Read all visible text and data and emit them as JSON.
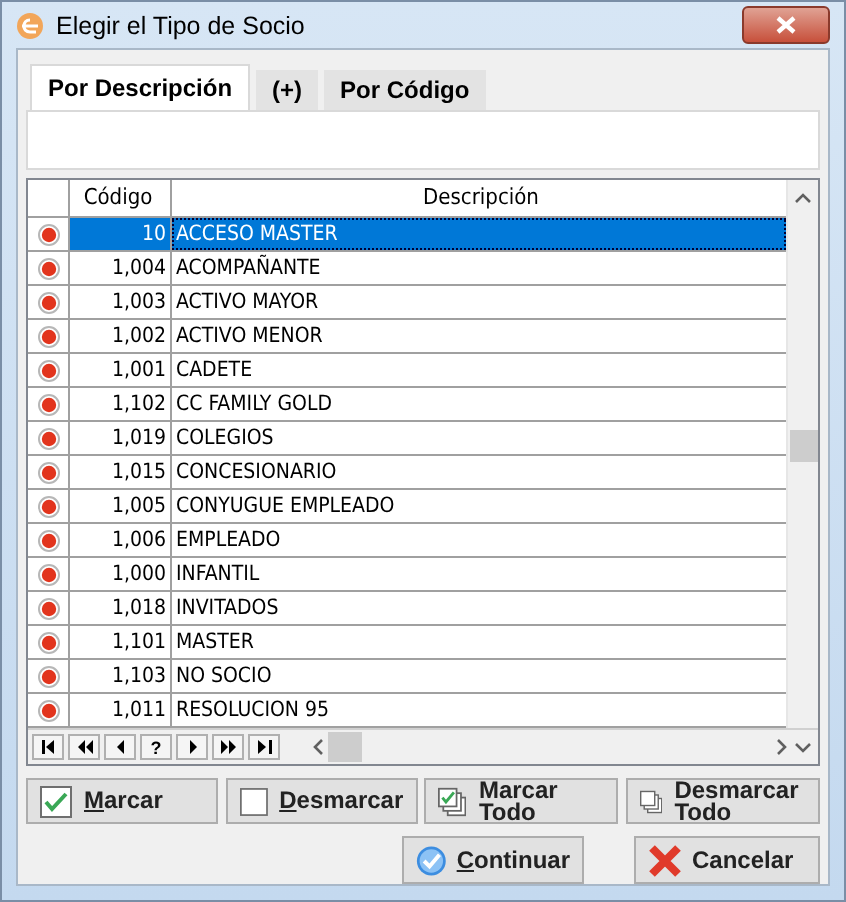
{
  "window": {
    "title": "Elegir el Tipo de Socio"
  },
  "tabs": [
    {
      "label": "Por Descripción",
      "selected": true
    },
    {
      "label": "(+)",
      "selected": false
    },
    {
      "label": "Por Código",
      "selected": false
    }
  ],
  "table": {
    "columns": [
      "Código",
      "Descripción"
    ],
    "rows": [
      {
        "codigo": "10",
        "descripcion": "ACCESO MASTER",
        "selected": true
      },
      {
        "codigo": "1,004",
        "descripcion": "ACOMPAÑANTE",
        "selected": false
      },
      {
        "codigo": "1,003",
        "descripcion": "ACTIVO MAYOR",
        "selected": false
      },
      {
        "codigo": "1,002",
        "descripcion": "ACTIVO MENOR",
        "selected": false
      },
      {
        "codigo": "1,001",
        "descripcion": "CADETE",
        "selected": false
      },
      {
        "codigo": "1,102",
        "descripcion": "CC FAMILY GOLD",
        "selected": false
      },
      {
        "codigo": "1,019",
        "descripcion": "COLEGIOS",
        "selected": false
      },
      {
        "codigo": "1,015",
        "descripcion": "CONCESIONARIO",
        "selected": false
      },
      {
        "codigo": "1,005",
        "descripcion": "CONYUGUE EMPLEADO",
        "selected": false
      },
      {
        "codigo": "1,006",
        "descripcion": "EMPLEADO",
        "selected": false
      },
      {
        "codigo": "1,000",
        "descripcion": "INFANTIL",
        "selected": false
      },
      {
        "codigo": "1,018",
        "descripcion": "INVITADOS",
        "selected": false
      },
      {
        "codigo": "1,101",
        "descripcion": "MASTER",
        "selected": false
      },
      {
        "codigo": "1,103",
        "descripcion": "NO SOCIO",
        "selected": false
      },
      {
        "codigo": "1,011",
        "descripcion": "RESOLUCION 95",
        "selected": false
      }
    ]
  },
  "navigator": [
    {
      "kind": "first"
    },
    {
      "kind": "prior_page"
    },
    {
      "kind": "prior"
    },
    {
      "kind": "text",
      "label": "?"
    },
    {
      "kind": "next"
    },
    {
      "kind": "next_page"
    },
    {
      "kind": "last"
    }
  ],
  "mark_buttons": [
    {
      "kind": "check",
      "label": "Marcar",
      "accel_first": true
    },
    {
      "kind": "uncheck",
      "label": "Desmarcar",
      "accel_first": true
    },
    {
      "kind": "check_all",
      "label": "Marcar Todo",
      "accel_first": false
    },
    {
      "kind": "uncheck_all",
      "label": "Desmarcar Todo",
      "accel_first": false
    }
  ],
  "action_buttons": [
    {
      "kind": "ok",
      "label": "Continuar",
      "accel_first": true
    },
    {
      "kind": "cancel",
      "label": "Cancelar",
      "accel_first": false
    }
  ]
}
